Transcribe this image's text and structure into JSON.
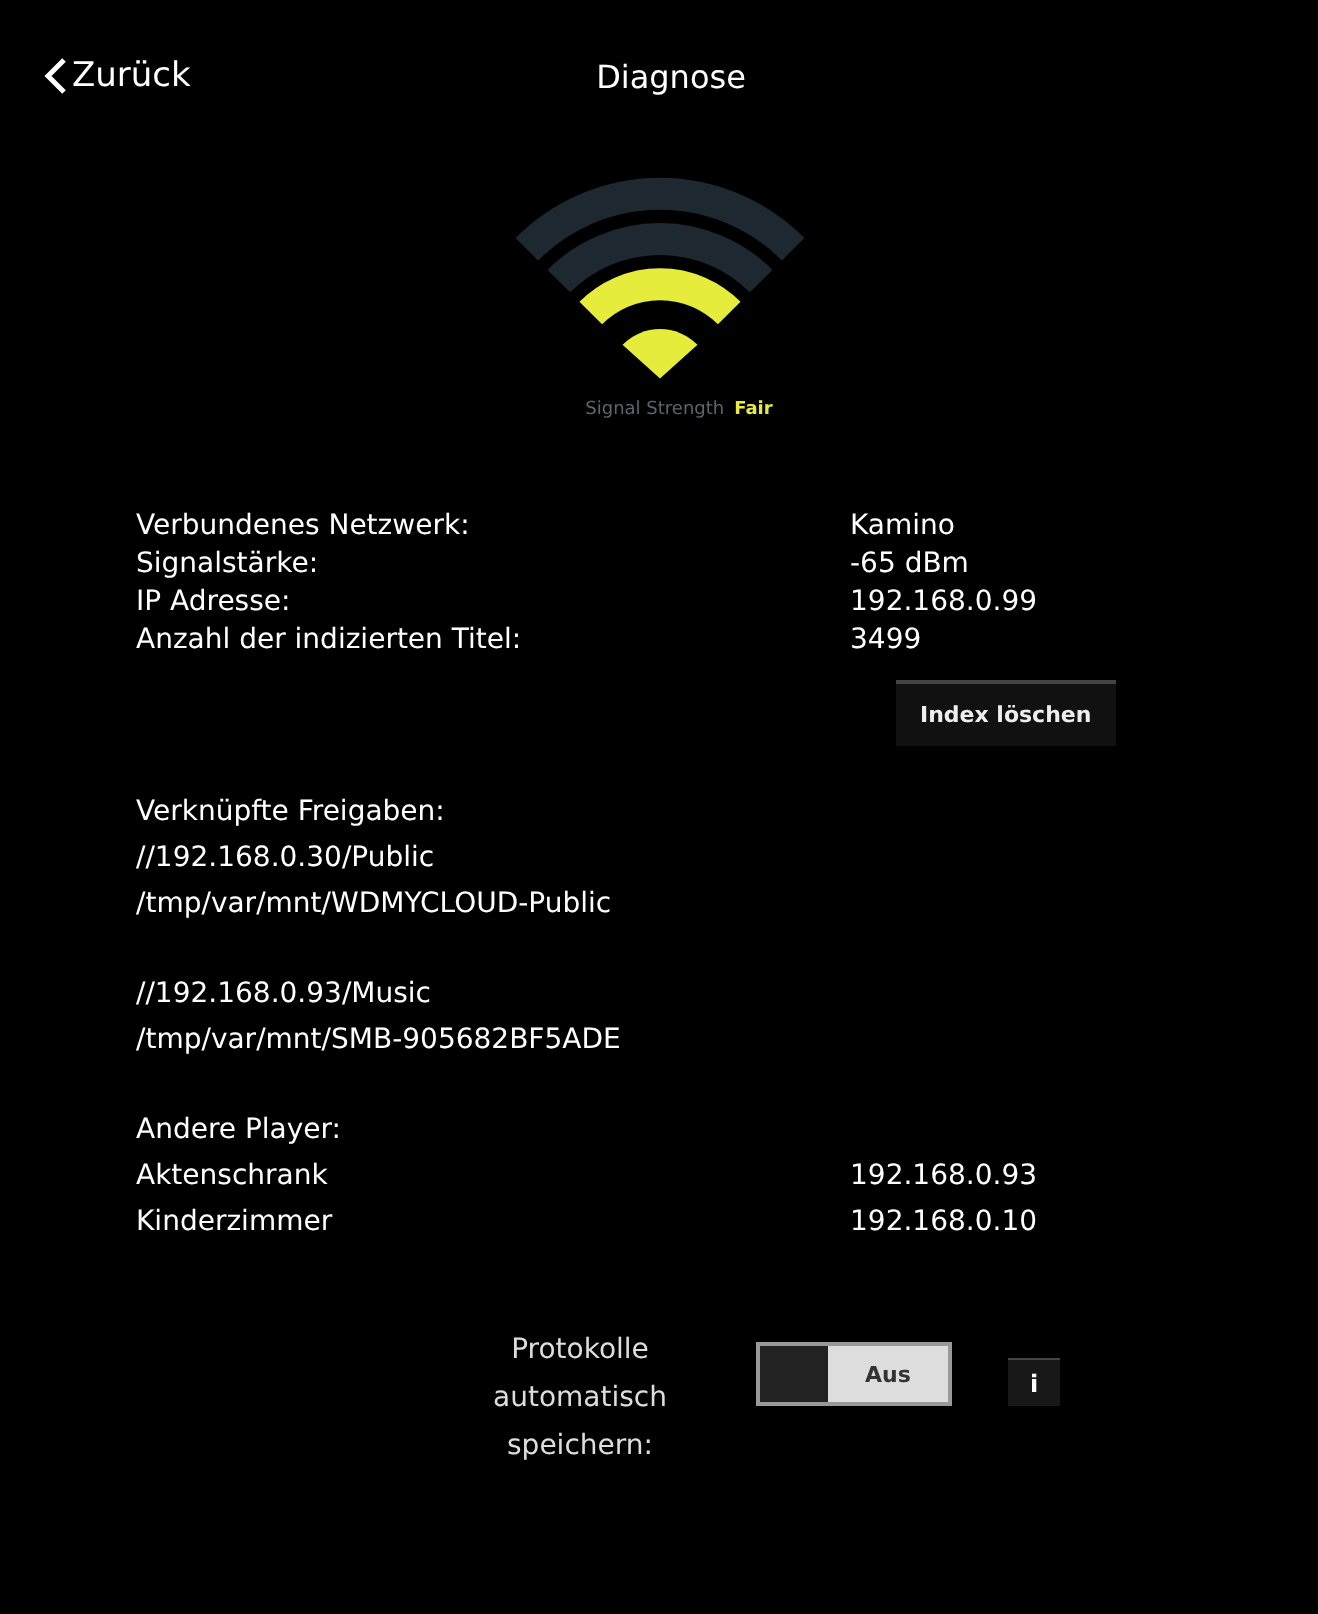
{
  "header": {
    "back": "Zurück",
    "title": "Diagnose"
  },
  "signal": {
    "level": 0.5,
    "label": "Signal Strength",
    "rating": "Fair"
  },
  "network": [
    {
      "label": "Verbundenes Netzwerk:",
      "value": "Kamino"
    },
    {
      "label": "Signalstärke:",
      "value": "-65 dBm"
    },
    {
      "label": "IP Adresse:",
      "value": "192.168.0.99"
    },
    {
      "label": "Anzahl der indizierten Titel:",
      "value": "3499"
    }
  ],
  "index_button": "Index löschen",
  "shares": {
    "title": "Verknüpfte Freigaben:",
    "items": [
      {
        "path": "//192.168.0.30/Public",
        "mount": "/tmp/var/mnt/WDMYCLOUD-Public"
      },
      {
        "path": "//192.168.0.93/Music",
        "mount": "/tmp/var/mnt/SMB-905682BF5ADE"
      }
    ]
  },
  "players": {
    "title": "Andere Player:",
    "items": [
      {
        "name": "Aktenschrank",
        "ip": "192.168.0.93"
      },
      {
        "name": "Kinderzimmer",
        "ip": "192.168.0.10"
      }
    ]
  },
  "logging": {
    "label": "Protokolle automatisch speichern:",
    "on": false,
    "state_label": "Aus",
    "info": "i"
  }
}
